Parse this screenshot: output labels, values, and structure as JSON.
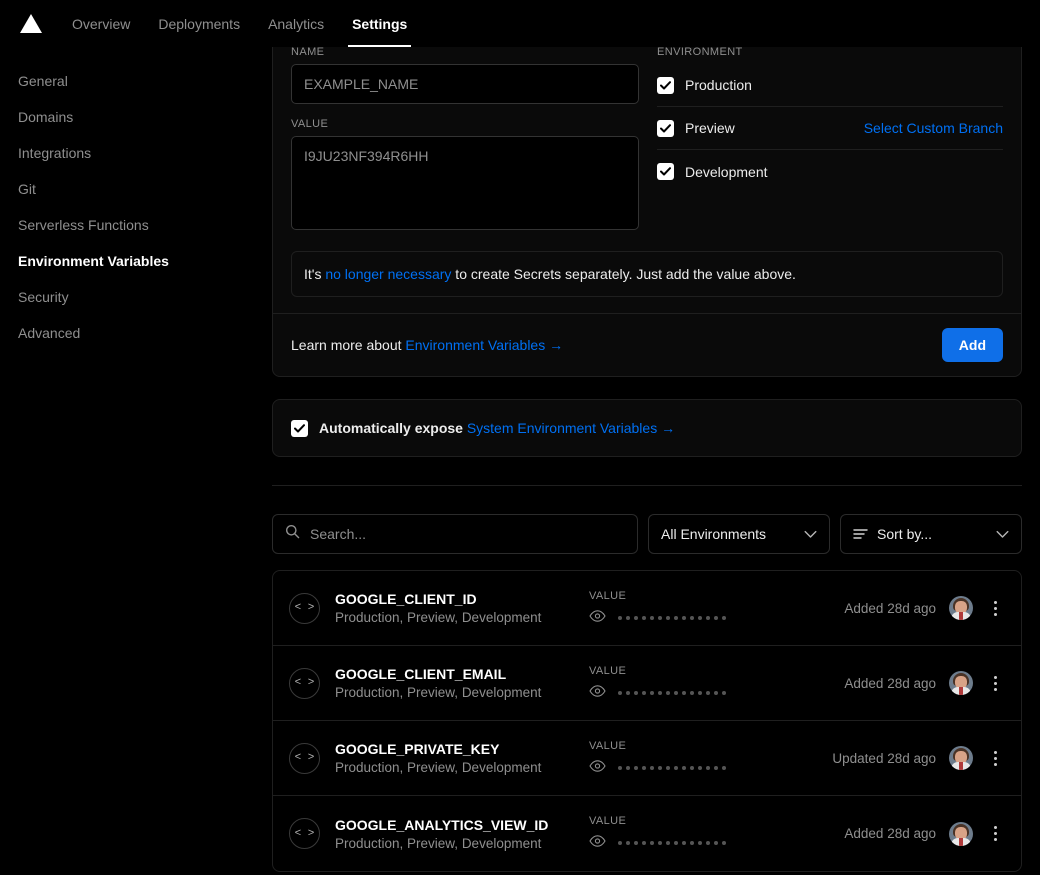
{
  "topnav": {
    "logo_icon": "vercel-triangle-logo",
    "tabs": [
      {
        "label": "Overview",
        "active": false
      },
      {
        "label": "Deployments",
        "active": false
      },
      {
        "label": "Analytics",
        "active": false
      },
      {
        "label": "Settings",
        "active": true
      }
    ]
  },
  "sidebar": {
    "items": [
      {
        "label": "General",
        "active": false
      },
      {
        "label": "Domains",
        "active": false
      },
      {
        "label": "Integrations",
        "active": false
      },
      {
        "label": "Git",
        "active": false
      },
      {
        "label": "Serverless Functions",
        "active": false
      },
      {
        "label": "Environment Variables",
        "active": true
      },
      {
        "label": "Security",
        "active": false
      },
      {
        "label": "Advanced",
        "active": false
      }
    ]
  },
  "add_form": {
    "name_label": "NAME",
    "name_placeholder": "EXAMPLE_NAME",
    "name_value": "",
    "value_label": "VALUE",
    "value_placeholder": "I9JU23NF394R6HH",
    "value_value": "",
    "environment_label": "ENVIRONMENT",
    "environments": [
      {
        "label": "Production",
        "checked": true,
        "action": ""
      },
      {
        "label": "Preview",
        "checked": true,
        "action": "Select Custom Branch"
      },
      {
        "label": "Development",
        "checked": true,
        "action": ""
      }
    ],
    "notice_prefix": "It's ",
    "notice_link": "no longer necessary",
    "notice_suffix": " to create Secrets separately. Just add the value above.",
    "learn_more_prefix": "Learn more about ",
    "learn_more_link": "Environment Variables →",
    "add_button": "Add"
  },
  "expose": {
    "checked": true,
    "text_prefix": "Automatically expose ",
    "link": "System Environment Variables →"
  },
  "toolbar": {
    "search_placeholder": "Search...",
    "search_value": "",
    "search_icon": "search-icon",
    "environment_filter": "All Environments",
    "sort_label": "Sort by...",
    "sort_icon": "sort-lines-icon",
    "chevron_icon": "chevron-down-icon"
  },
  "variables": {
    "value_label": "VALUE",
    "masked_dots": 14,
    "items": [
      {
        "name": "GOOGLE_CLIENT_ID",
        "targets": "Production, Preview, Development",
        "date": "Added 28d ago",
        "icon": "code-brackets-icon",
        "eye_icon": "eye-icon",
        "avatar": "user-avatar",
        "menu_icon": "kebab-menu-icon"
      },
      {
        "name": "GOOGLE_CLIENT_EMAIL",
        "targets": "Production, Preview, Development",
        "date": "Added 28d ago",
        "icon": "code-brackets-icon",
        "eye_icon": "eye-icon",
        "avatar": "user-avatar",
        "menu_icon": "kebab-menu-icon"
      },
      {
        "name": "GOOGLE_PRIVATE_KEY",
        "targets": "Production, Preview, Development",
        "date": "Updated 28d ago",
        "icon": "code-brackets-icon",
        "eye_icon": "eye-icon",
        "avatar": "user-avatar",
        "menu_icon": "kebab-menu-icon"
      },
      {
        "name": "GOOGLE_ANALYTICS_VIEW_ID",
        "targets": "Production, Preview, Development",
        "date": "Added 28d ago",
        "icon": "code-brackets-icon",
        "eye_icon": "eye-icon",
        "avatar": "user-avatar",
        "menu_icon": "kebab-menu-icon"
      }
    ]
  },
  "colors": {
    "accent_blue": "#0070f3",
    "button_blue": "#0f6fe8",
    "page_bg": "#000000",
    "panel_bg": "#0a0a0a",
    "border": "#1f1f1f",
    "muted_text": "#8f8f8f"
  }
}
